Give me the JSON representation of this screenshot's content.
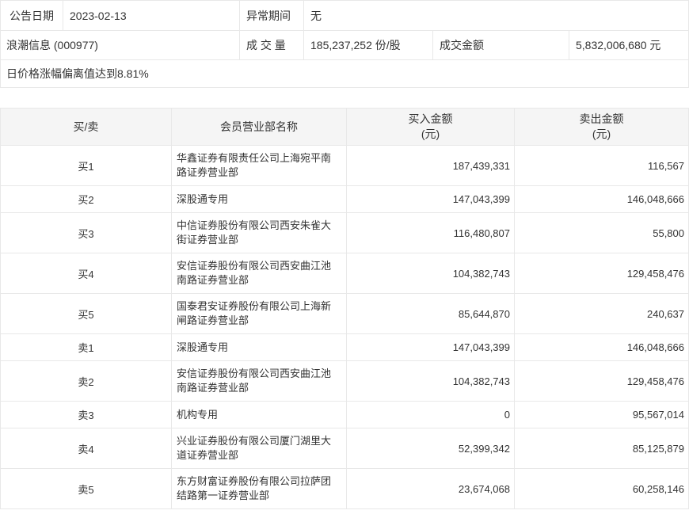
{
  "info": {
    "announce_date_label": "公告日期",
    "announce_date": "2023-02-13",
    "abnormal_period_label": "异常期间",
    "abnormal_period": "无",
    "stock_name": "浪潮信息 (000977)",
    "volume_label": "成 交 量",
    "volume": "185,237,252 份/股",
    "turnover_label": "成交金额",
    "turnover": "5,832,006,680 元",
    "notice": "日价格涨幅偏离值达到8.81%"
  },
  "table": {
    "headers": {
      "side": "买/卖",
      "branch": "会员营业部名称",
      "buy": "买入金额",
      "buy_unit": "(元)",
      "sell": "卖出金额",
      "sell_unit": "(元)"
    },
    "rows": [
      {
        "side": "买1",
        "branch": "华鑫证券有限责任公司上海宛平南路证券营业部",
        "buy": "187,439,331",
        "sell": "116,567"
      },
      {
        "side": "买2",
        "branch": "深股通专用",
        "buy": "147,043,399",
        "sell": "146,048,666"
      },
      {
        "side": "买3",
        "branch": "中信证券股份有限公司西安朱雀大街证券营业部",
        "buy": "116,480,807",
        "sell": "55,800"
      },
      {
        "side": "买4",
        "branch": "安信证券股份有限公司西安曲江池南路证券营业部",
        "buy": "104,382,743",
        "sell": "129,458,476"
      },
      {
        "side": "买5",
        "branch": "国泰君安证券股份有限公司上海新闸路证券营业部",
        "buy": "85,644,870",
        "sell": "240,637"
      },
      {
        "side": "卖1",
        "branch": "深股通专用",
        "buy": "147,043,399",
        "sell": "146,048,666"
      },
      {
        "side": "卖2",
        "branch": "安信证券股份有限公司西安曲江池南路证券营业部",
        "buy": "104,382,743",
        "sell": "129,458,476"
      },
      {
        "side": "卖3",
        "branch": "机构专用",
        "buy": "0",
        "sell": "95,567,014"
      },
      {
        "side": "卖4",
        "branch": "兴业证券股份有限公司厦门湖里大道证券营业部",
        "buy": "52,399,342",
        "sell": "85,125,879"
      },
      {
        "side": "卖5",
        "branch": "东方财富证券股份有限公司拉萨团结路第一证券营业部",
        "buy": "23,674,068",
        "sell": "60,258,146"
      }
    ]
  },
  "colors": {
    "border": "#e8e8e8",
    "header_bg": "#f5f5f5",
    "text": "#333333"
  }
}
